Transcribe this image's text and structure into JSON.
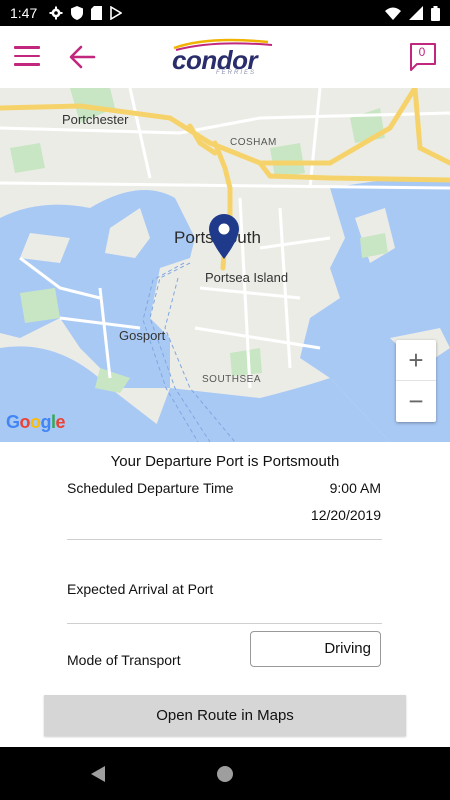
{
  "status_bar": {
    "time": "1:47",
    "left_icons": [
      "settings-icon",
      "shield-icon",
      "sd-card-icon",
      "play-store-icon"
    ],
    "right_icons": [
      "wifi-icon",
      "signal-icon",
      "battery-icon"
    ]
  },
  "header": {
    "logo_text": "condor",
    "logo_subtext": "FERRIES",
    "chat_count": "0",
    "accent_color": "#c0277d",
    "logo_color": "#2a2d6b"
  },
  "map": {
    "labels": {
      "portchester": "Portchester",
      "cosham": "COSHAM",
      "portsmouth": "Portsmouth",
      "portsea_island": "Portsea Island",
      "gosport": "Gosport",
      "southsea": "SOUTHSEA"
    },
    "zoom_in": "+",
    "zoom_out": "−",
    "attribution": "Google"
  },
  "details": {
    "departure_title": "Your Departure Port is Portsmouth",
    "scheduled_label": "Scheduled Departure Time",
    "scheduled_time": "9:00 AM",
    "scheduled_date": "12/20/2019",
    "arrival_label": "Expected Arrival at Port",
    "transport_label": "Mode of Transport",
    "transport_value": "Driving",
    "open_route_button": "Open Route in Maps"
  }
}
